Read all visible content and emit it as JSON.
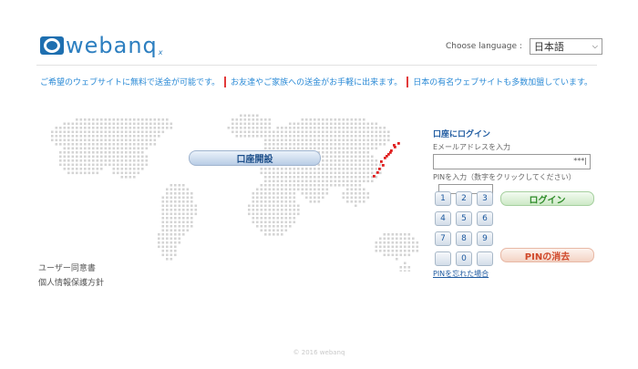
{
  "header": {
    "logo_text": "webanq",
    "logo_sub": "x",
    "language_label": "Choose language :",
    "language_selected": "日本語"
  },
  "taglines": [
    "ご希望のウェブサイトに無料で送金が可能です。",
    "お友達やご家族への送金がお手軽に出来ます。",
    "日本の有名ウェブサイトも多数加盟しています。"
  ],
  "main": {
    "open_account_label": "口座開設",
    "left_links": [
      "ユーザー同意書",
      "個人情報保護方針"
    ]
  },
  "login": {
    "title": "口座にログイン",
    "email_label": "Eメールアドレスを入力",
    "email_value": "***|",
    "pin_label": "PINを入力（数字をクリックしてください）",
    "keys": [
      "1",
      "2",
      "3",
      "4",
      "5",
      "6",
      "7",
      "8",
      "9",
      "",
      "0",
      ""
    ],
    "login_button": "ログイン",
    "clear_button": "PINの消去",
    "forgot_link": "PINを忘れた場合"
  },
  "footer": {
    "copyright": "© 2016 webanq"
  },
  "colors": {
    "brand": "#2d7fc0",
    "tag_text": "#2a8ad6",
    "separator": "#e23a3a",
    "map_dot": "#d4d4d4",
    "japan_dot": "#e02020"
  }
}
